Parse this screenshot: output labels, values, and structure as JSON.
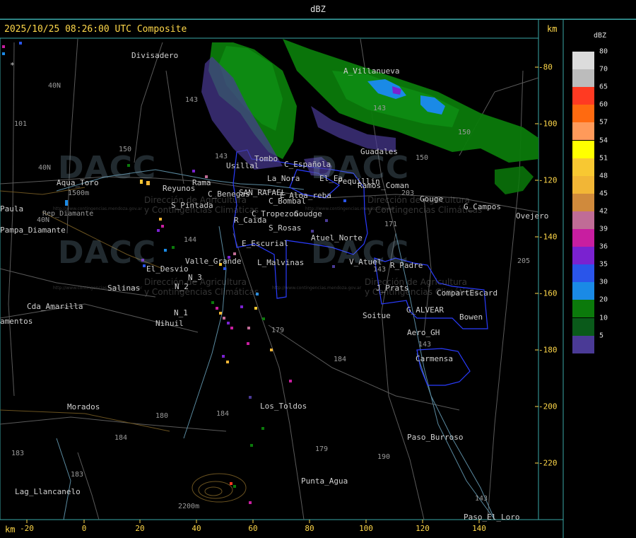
{
  "header": {
    "title": "dBZ"
  },
  "map": {
    "timestamp": "2025/10/25 08:26:00 UTC Composite",
    "unit_top": "km",
    "unit_bottom": "km",
    "x_ticks": [
      "-20",
      "0",
      "20",
      "40",
      "60",
      "80",
      "100",
      "120",
      "140"
    ],
    "y_ticks": [
      "-80",
      "-100",
      "-120",
      "-140",
      "-160",
      "-180",
      "-200",
      "-220"
    ],
    "places": [
      "Divisadero",
      "A_Villanueva",
      "Guadales",
      "Usillal",
      "Tombo",
      "C_Española",
      "La_Nora",
      "El_Ea",
      "Goudge",
      "Aqua_Toro",
      "SAN_RAFAEL",
      "Pequillin",
      "Ramos_Coman",
      "Rama",
      "Reyunos",
      "C_Benegas",
      "C_Bombal",
      "E_Aloa_reba",
      "Gouge",
      "G_Campos",
      "Ovejero",
      "S_Pintada",
      "C_Tropezon",
      "Goudge",
      "Paula",
      "Pampa_Diamante",
      "R_Caida",
      "S_Rosas",
      "Atuel_Norte",
      "E_Escurial",
      "Valle_Grande",
      "L_Malvinas",
      "V_Atuel",
      "R_Padre",
      "El_Desvio",
      "Salinas",
      "N_2",
      "N_3",
      "J_Prats",
      "CompartEscard",
      "Cda_Amarilla",
      "N_1",
      "Nihuil",
      "G_ALVEAR",
      "Soitue",
      "Bowen",
      "amentos",
      "Aero_GH",
      "Carmensa",
      "Morados",
      "Los_Toldos",
      "Paso_Burroso",
      "Punta_Agua",
      "Lag_Llancanelo",
      "Paso_El_Loro",
      "1500m",
      "2200m",
      "Rep_Diamante",
      "*"
    ],
    "roads": [
      "40N",
      "40N",
      "40N",
      "143",
      "150",
      "143",
      "101",
      "144",
      "143",
      "203",
      "171",
      "143",
      "179",
      "184",
      "180",
      "184",
      "183",
      "184",
      "179",
      "190",
      "143",
      "205",
      "150"
    ],
    "watermark": {
      "logo_text": "DACC",
      "subtitle_1": "Dirección de Agricultura",
      "subtitle_2": "y Contingencias Climáticas",
      "url": "http://www.contingencias.mendoza.gov.ar"
    }
  },
  "legend": {
    "title": "dBZ",
    "levels": [
      {
        "value": "80",
        "color": "#dcdcdc"
      },
      {
        "value": "70",
        "color": "#bcbcbc"
      },
      {
        "value": "65",
        "color": "#ff3a22"
      },
      {
        "value": "60",
        "color": "#ff6a10"
      },
      {
        "value": "57",
        "color": "#ff9a5a"
      },
      {
        "value": "54",
        "color": "#ffff00"
      },
      {
        "value": "51",
        "color": "#f8c832"
      },
      {
        "value": "48",
        "color": "#f2b636"
      },
      {
        "value": "45",
        "color": "#d08a3c"
      },
      {
        "value": "42",
        "color": "#c06c96"
      },
      {
        "value": "39",
        "color": "#c81ea0"
      },
      {
        "value": "36",
        "color": "#7a22d0"
      },
      {
        "value": "35",
        "color": "#2a55ea"
      },
      {
        "value": "30",
        "color": "#1a8ae6"
      },
      {
        "value": "20",
        "color": "#0b7a0b"
      },
      {
        "value": "10",
        "color": "#0a5a1a"
      },
      {
        "value": "5",
        "color": "#4a3a96"
      }
    ]
  }
}
